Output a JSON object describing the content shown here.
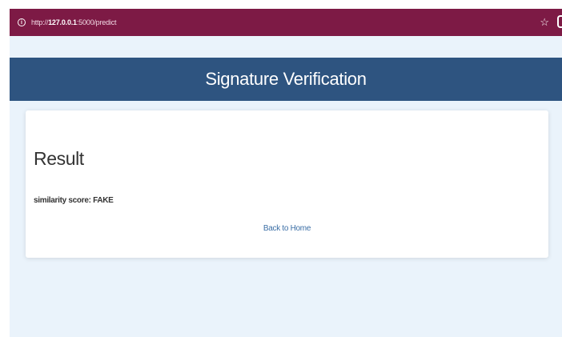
{
  "browser": {
    "url_prefix": "http://",
    "url_host": "127.0.0.1",
    "url_rest": ":5000/predict",
    "info_icon": "info-icon",
    "bookmark_icon": "star-icon",
    "bookmark_glyph": "☆",
    "info_glyph": "i",
    "bar_color": "#7d1a45"
  },
  "header": {
    "title": "Signature Verification",
    "color": "#2e5480"
  },
  "result": {
    "heading": "Result",
    "score_text": "similarity score: FAKE",
    "back_link": "Back to Home"
  }
}
